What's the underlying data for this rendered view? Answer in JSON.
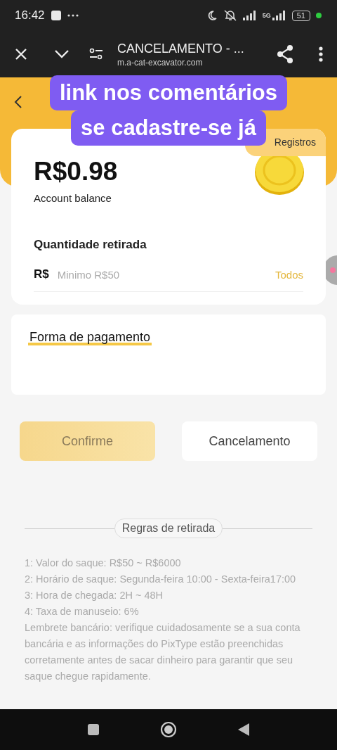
{
  "status_bar": {
    "time": "16:42",
    "battery": "51",
    "network": "5G"
  },
  "browser_bar": {
    "title": "CANCELAMENTO - ...",
    "url": "m.a-cat-excavator.com"
  },
  "header": {
    "records_tab": "Registros"
  },
  "balance_card": {
    "amount": "R$0.98",
    "label": "Account balance",
    "withdraw_label": "Quantidade retirada",
    "currency": "R$",
    "placeholder": "Minimo R$50",
    "all_link": "Todos"
  },
  "payment_card": {
    "title": "Forma de pagamento"
  },
  "buttons": [
    {
      "label": "Confirme",
      "kind": "primary",
      "disabled": true
    },
    {
      "label": "Cancelamento",
      "kind": "secondary",
      "disabled": false
    }
  ],
  "rules": {
    "title": "Regras de retirada",
    "lines": [
      "1: Valor do saque: R$50 ~ R$6000",
      "2: Horário de saque: Segunda-feira 10:00 - Sexta-feira17:00",
      "3: Hora de chegada: 2H ~ 48H",
      "4: Taxa de manuseio: 6%",
      "Lembrete bancário: verifique cuidadosamente se a sua conta bancária e as informações do PixType estão preenchidas corretamente antes de sacar dinheiro para garantir que seu saque chegue rapidamente."
    ]
  },
  "caption_lines": [
    "link nos comentários",
    "se cadastre-se já"
  ]
}
